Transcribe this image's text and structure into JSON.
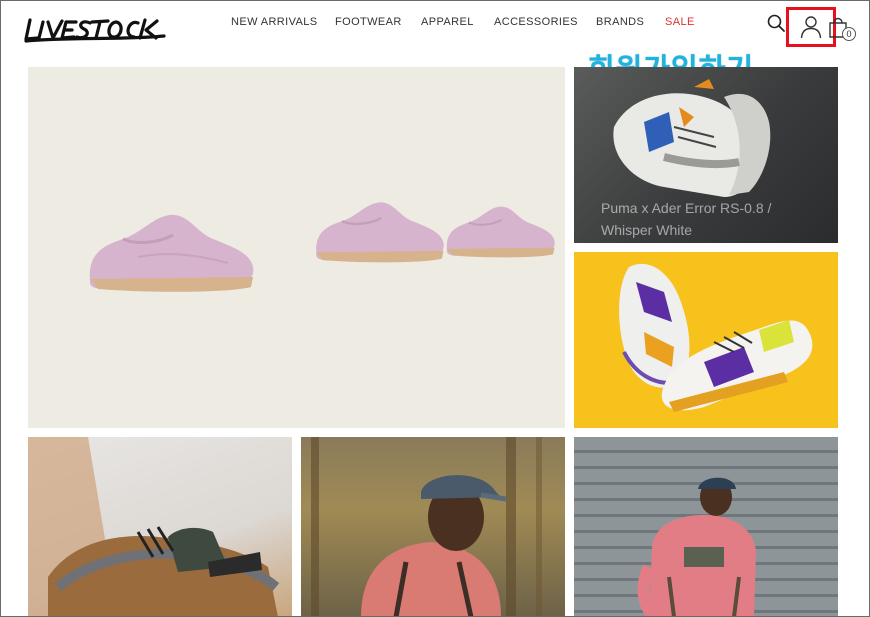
{
  "brand": {
    "logo_text": "LIVESTOCK"
  },
  "nav": {
    "items": [
      {
        "label": "NEW ARRIVALS"
      },
      {
        "label": "FOOTWEAR"
      },
      {
        "label": "APPAREL"
      },
      {
        "label": "ACCESSORIES"
      },
      {
        "label": "BRANDS"
      },
      {
        "label": "SALE"
      }
    ]
  },
  "header_icons": {
    "search": "search-icon",
    "account": "user-icon",
    "cart": "shopping-bag-icon",
    "cart_count": "0",
    "highlight_color": "#e8101a"
  },
  "annotation": {
    "text": "회원가입하기",
    "color": "#1eb4e0"
  },
  "tiles": {
    "puma_ader": {
      "caption": "Puma x Ader Error RS-0.8 / Whisper White"
    }
  },
  "colors": {
    "sale": "#e0312f",
    "hero_bg": "#edebe2",
    "yellow_bg": "#f7c21b"
  }
}
